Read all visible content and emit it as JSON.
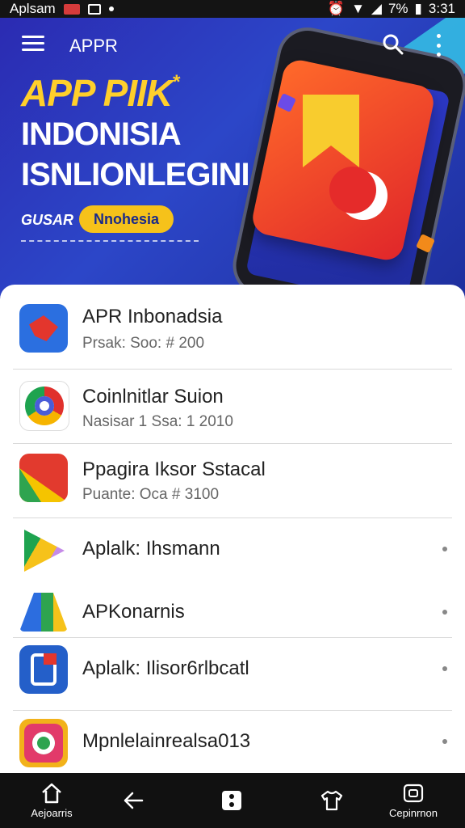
{
  "status_bar": {
    "carrier": "Aplsam",
    "battery": "7%",
    "time": "3:31"
  },
  "header": {
    "app_name": "APPR",
    "menu_icon": "hamburger-menu-icon",
    "search_icon": "search-icon",
    "more_icon": "more-vert-icon"
  },
  "banner": {
    "title": "APP PIIK",
    "title_mark": "*",
    "subtitle_line1": "INDONISIA",
    "subtitle_line2": "ISNLIONLEGINI",
    "label": "GUSAR",
    "pill": "Nnohesia"
  },
  "list": [
    {
      "title": "APR Inbonadsia",
      "sub": "Prsak: Soo: # 200",
      "icon": "app-icon-red-blue"
    },
    {
      "title": "Coinlnitlar Suion",
      "sub": "Nasisar 1 Ssa: 1 2010",
      "icon": "app-icon-multicolor-ring"
    },
    {
      "title": "Ppagira Iksor Sstacal",
      "sub": "Puante: Oca # 3100",
      "icon": "app-icon-red-check"
    },
    {
      "title": "Aplalk: Ihsmann",
      "sub": "",
      "icon": "app-icon-play-triangle"
    },
    {
      "title": "APKonarnis",
      "sub": "",
      "icon": "app-icon-drive-triangle"
    },
    {
      "title": "Aplalk: Ilisor6rlbcatl",
      "sub": "",
      "icon": "app-icon-blue-doc"
    },
    {
      "title": "Mpnlelainrealsa013",
      "sub": "",
      "icon": "app-icon-yellow-camera"
    }
  ],
  "bottom_nav": [
    {
      "label": "Aejoarris",
      "icon": "home-icon"
    },
    {
      "label": "",
      "icon": "back-arrow-icon"
    },
    {
      "label": "",
      "icon": "dice-icon"
    },
    {
      "label": "",
      "icon": "shirt-icon"
    },
    {
      "label": "Cepinrnon",
      "icon": "camera-switch-icon"
    }
  ],
  "colors": {
    "banner_bg": "#2b2bb2",
    "accent_yellow": "#f6c21a",
    "accent_red": "#e52b2a"
  }
}
